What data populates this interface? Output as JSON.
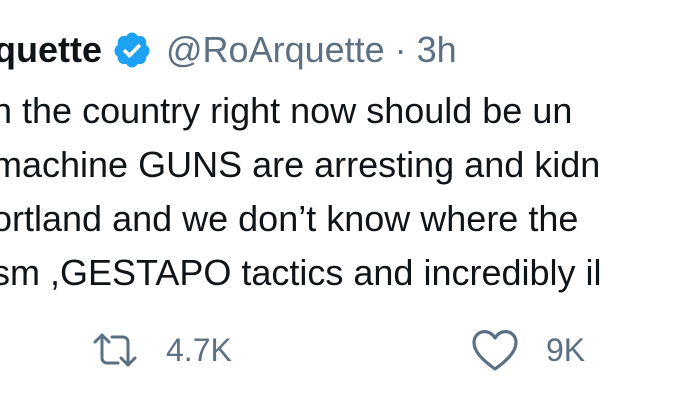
{
  "tweet": {
    "display_name": "quette",
    "handle": "@RoArquette",
    "separator": "·",
    "time": "3h",
    "lines": [
      "n the country right now should be un",
      "machine GUNS are arresting and kidn",
      "ortland  and we don’t know where the",
      "sm ,GESTAPO tactics and incredibly il"
    ]
  },
  "actions": {
    "retweet_count": "4.7K",
    "like_count": "9K"
  },
  "icons": {
    "verified": "verified-badge-icon",
    "retweet": "retweet-icon",
    "like": "heart-icon"
  },
  "colors": {
    "verified_blue": "#1da1f2",
    "secondary_text": "#5b7083",
    "primary_text": "#0f1419"
  }
}
